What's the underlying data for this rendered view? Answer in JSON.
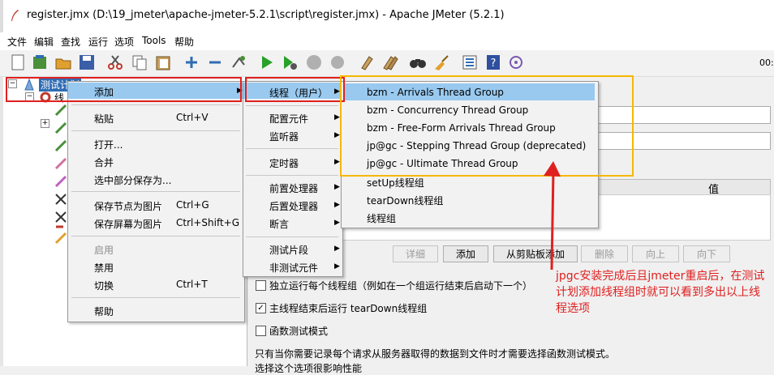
{
  "window": {
    "title": "register.jmx (D:\\19_jmeter\\apache-jmeter-5.2.1\\script\\register.jmx) - Apache JMeter (5.2.1)"
  },
  "menubar": {
    "items": [
      "文件",
      "编辑",
      "查找",
      "运行",
      "选项",
      "Tools",
      "帮助"
    ]
  },
  "toolbar": {
    "icons": [
      "new-icon",
      "templates-icon",
      "open-icon",
      "save-icon",
      "cut-icon",
      "copy-icon",
      "paste-icon",
      "expand-icon",
      "collapse-icon",
      "toggle-icon",
      "start-icon",
      "start-no-pause-icon",
      "stop-icon",
      "shutdown-icon",
      "clear-icon",
      "clear-all-icon",
      "search-icon",
      "reset-search-icon",
      "function-helper-icon",
      "help-icon",
      "remote-icon"
    ],
    "timer": "00:"
  },
  "tree": {
    "root_label": "测试计划",
    "child_label": "线"
  },
  "context_menu": {
    "add": "添加",
    "paste": "粘贴",
    "paste_sc": "Ctrl+V",
    "open": "打开...",
    "merge": "合并",
    "save_selection": "选中部分保存为...",
    "save_node_image": "保存节点为图片",
    "save_node_image_sc": "Ctrl+G",
    "save_screen_image": "保存屏幕为图片",
    "save_screen_image_sc": "Ctrl+Shift+G",
    "enable": "启用",
    "disable": "禁用",
    "toggle": "切换",
    "toggle_sc": "Ctrl+T",
    "help": "帮助"
  },
  "add_submenu": {
    "threads": "线程（用户）",
    "config": "配置元件",
    "listener": "监听器",
    "timer": "定时器",
    "pre": "前置处理器",
    "post": "后置处理器",
    "assertion": "断言",
    "fragment": "测试片段",
    "non_test": "非测试元件"
  },
  "threads_submenu": {
    "items": [
      "bzm - Arrivals Thread Group",
      "bzm - Concurrency Thread Group",
      "bzm - Free-Form Arrivals Thread Group",
      "jp@gc - Stepping Thread Group (deprecated)",
      "jp@gc - Ultimate Thread Group",
      "setUp线程组",
      "tearDown线程组",
      "线程组"
    ]
  },
  "right_panel": {
    "table_value_header": "值",
    "buttons": {
      "detail": "详细",
      "add": "添加",
      "add_from_clipboard": "从剪贴板添加",
      "delete": "删除",
      "up": "向上",
      "down": "向下"
    },
    "checkboxes": {
      "independent": "独立运行每个线程组（例如在一个组运行结束后启动下一个）",
      "teardown": "主线程结束后运行 tearDown线程组",
      "functional": "函数测试模式"
    },
    "note": "只有当你需要记录每个请求从服务器取得的数据到文件时才需要选择函数测试模式。",
    "note2": "选择这个选项很影响性能"
  },
  "annotation": {
    "text": "jpgc安装完成后且jmeter重启后，在测试计划添加线程组时就可以看到多出以上线程选项",
    "color": "#e02020"
  },
  "colors": {
    "highlight": "#99c9ef",
    "annotation_box_red": "#e02020",
    "annotation_box_orange": "#f5b800"
  }
}
